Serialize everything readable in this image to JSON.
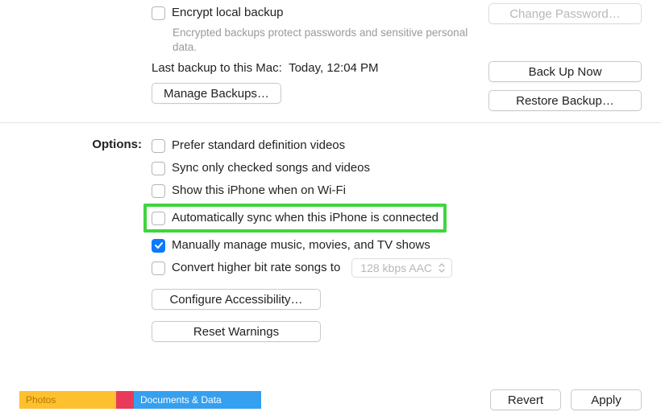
{
  "backup": {
    "encrypt_label": "Encrypt local backup",
    "encrypt_help": "Encrypted backups protect passwords and sensitive personal data.",
    "change_password": "Change Password…",
    "last_backup_prefix": "Last backup to this Mac:  ",
    "last_backup_value": "Today, 12:04 PM",
    "backup_now": "Back Up Now",
    "manage_backups": "Manage Backups…",
    "restore_backup": "Restore Backup…"
  },
  "options": {
    "label": "Options:",
    "prefer_sd": "Prefer standard definition videos",
    "sync_checked": "Sync only checked songs and videos",
    "show_wifi": "Show this iPhone when on Wi-Fi",
    "auto_sync": "Automatically sync when this iPhone is connected",
    "manual_manage": "Manually manage music, movies, and TV shows",
    "convert_bitrate": "Convert higher bit rate songs to",
    "bitrate_value": "128 kbps AAC",
    "configure_accessibility": "Configure Accessibility…",
    "reset_warnings": "Reset Warnings"
  },
  "storage": {
    "photos": "Photos",
    "docs": "Documents & Data"
  },
  "footer": {
    "revert": "Revert",
    "apply": "Apply"
  }
}
